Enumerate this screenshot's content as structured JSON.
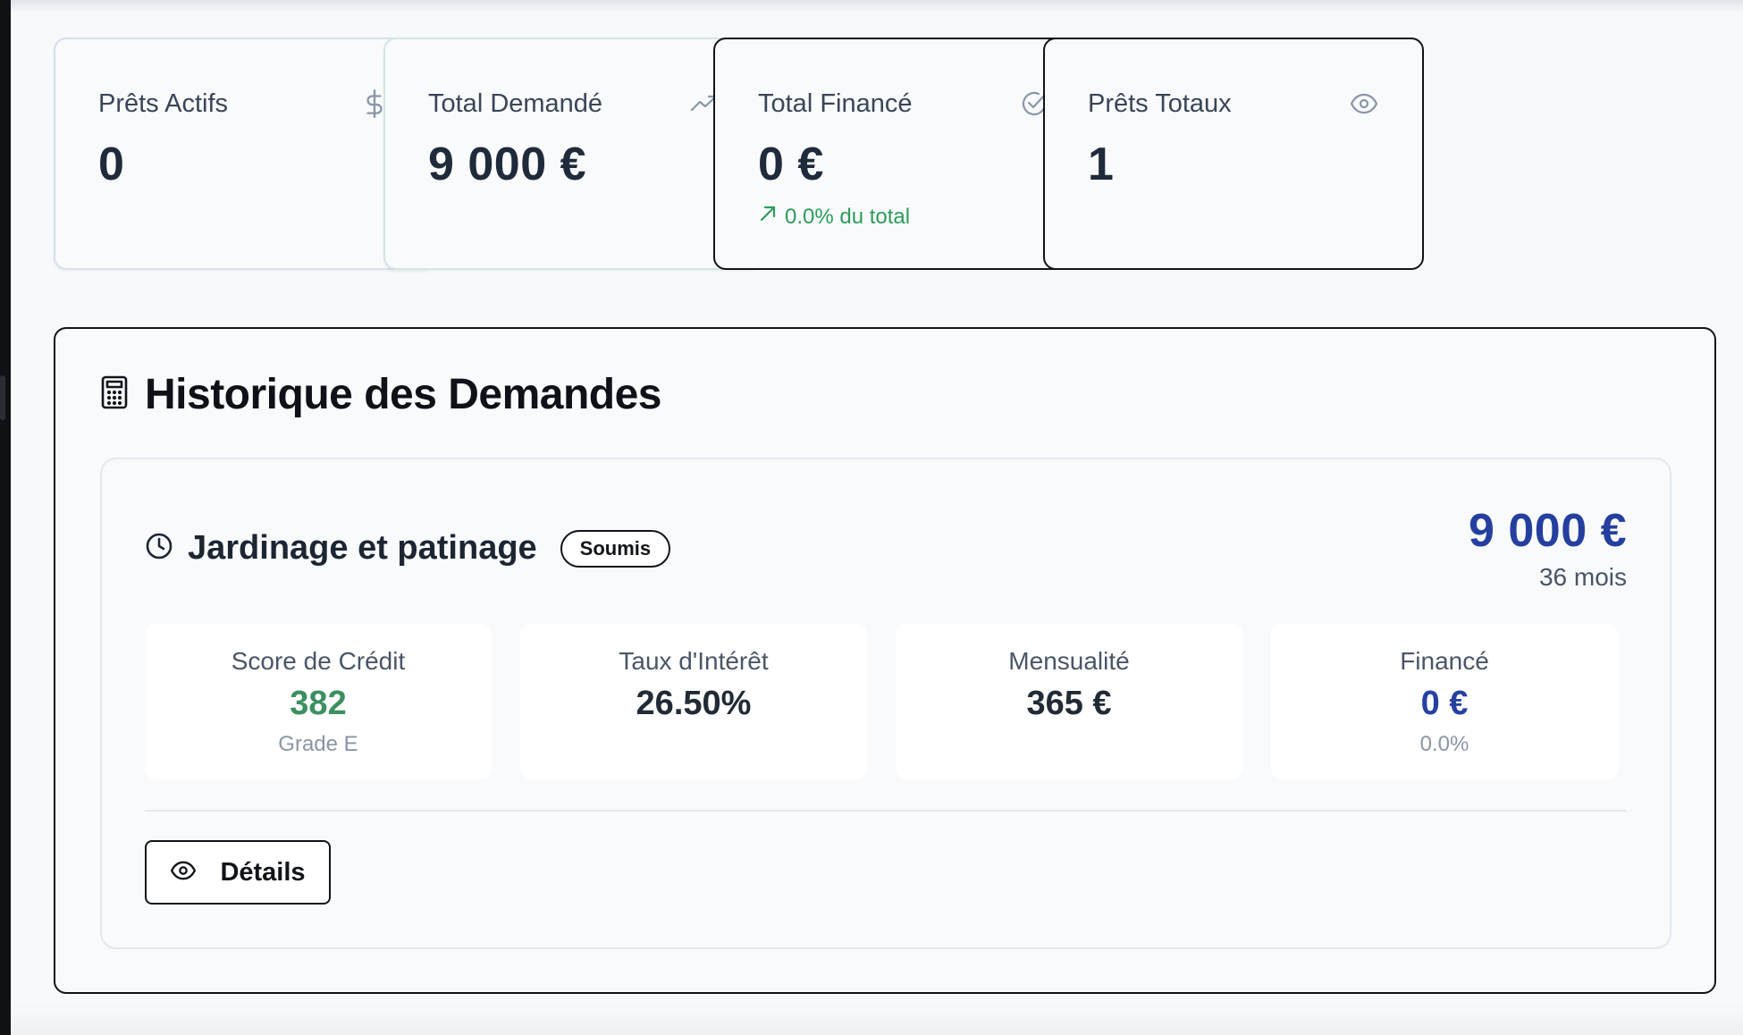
{
  "stats": [
    {
      "label": "Prêts Actifs",
      "value": "0",
      "icon": "dollar-icon"
    },
    {
      "label": "Total Demandé",
      "value": "9 000 €",
      "icon": "trending-up-icon"
    },
    {
      "label": "Total Financé",
      "value": "0 €",
      "icon": "check-circle-icon",
      "sub": "0.0% du total"
    },
    {
      "label": "Prêts Totaux",
      "value": "1",
      "icon": "eye-icon"
    }
  ],
  "history": {
    "title": "Historique des Demandes",
    "loan": {
      "name": "Jardinage et patinage",
      "status": "Soumis",
      "amount": "9 000 €",
      "duration": "36 mois",
      "metrics": [
        {
          "label": "Score de Crédit",
          "value": "382",
          "sub": "Grade E"
        },
        {
          "label": "Taux d'Intérêt",
          "value": "26.50%"
        },
        {
          "label": "Mensualité",
          "value": "365 €"
        },
        {
          "label": "Financé",
          "value": "0 €",
          "sub": "0.0%"
        }
      ],
      "details_label": "Détails"
    }
  },
  "colors": {
    "accent_blue": "#243f9e",
    "success_green": "#2e9a5a",
    "border_dark": "#111418"
  }
}
